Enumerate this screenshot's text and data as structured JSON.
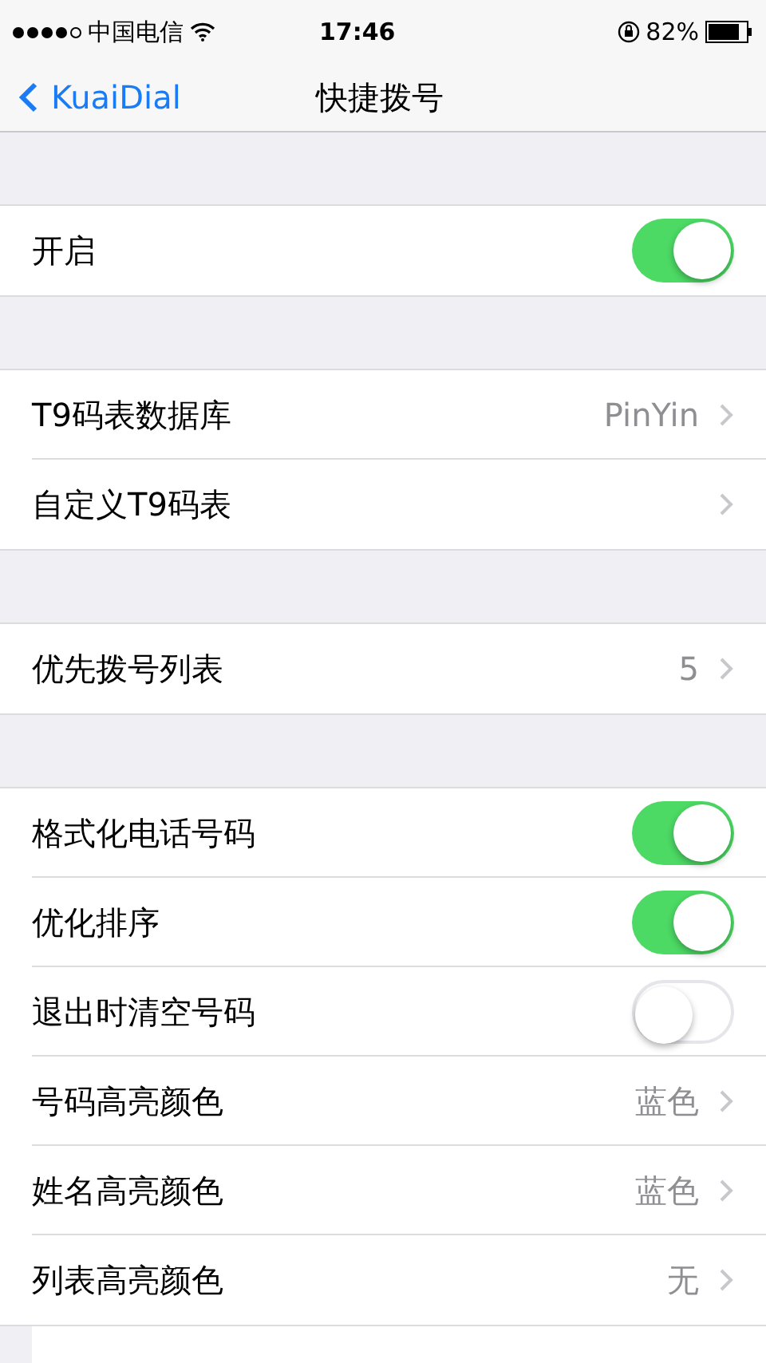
{
  "status_bar": {
    "carrier": "中国电信",
    "time": "17:46",
    "battery": "82%"
  },
  "nav": {
    "back": "KuaiDial",
    "title": "快捷拨号"
  },
  "sections": [
    {
      "rows": [
        {
          "kind": "toggle",
          "label": "开启",
          "on": true
        }
      ]
    },
    {
      "rows": [
        {
          "kind": "value",
          "label": "T9码表数据库",
          "value": "PinYin"
        },
        {
          "kind": "link",
          "label": "自定义T9码表"
        }
      ]
    },
    {
      "rows": [
        {
          "kind": "value",
          "label": "优先拨号列表",
          "value": "5"
        }
      ]
    },
    {
      "rows": [
        {
          "kind": "toggle",
          "label": "格式化电话号码",
          "on": true
        },
        {
          "kind": "toggle",
          "label": "优化排序",
          "on": true
        },
        {
          "kind": "toggle",
          "label": "退出时清空号码",
          "on": false
        },
        {
          "kind": "value",
          "label": "号码高亮颜色",
          "value": "蓝色"
        },
        {
          "kind": "value",
          "label": "姓名高亮颜色",
          "value": "蓝色"
        },
        {
          "kind": "value",
          "label": "列表高亮颜色",
          "value": "无"
        }
      ]
    }
  ]
}
